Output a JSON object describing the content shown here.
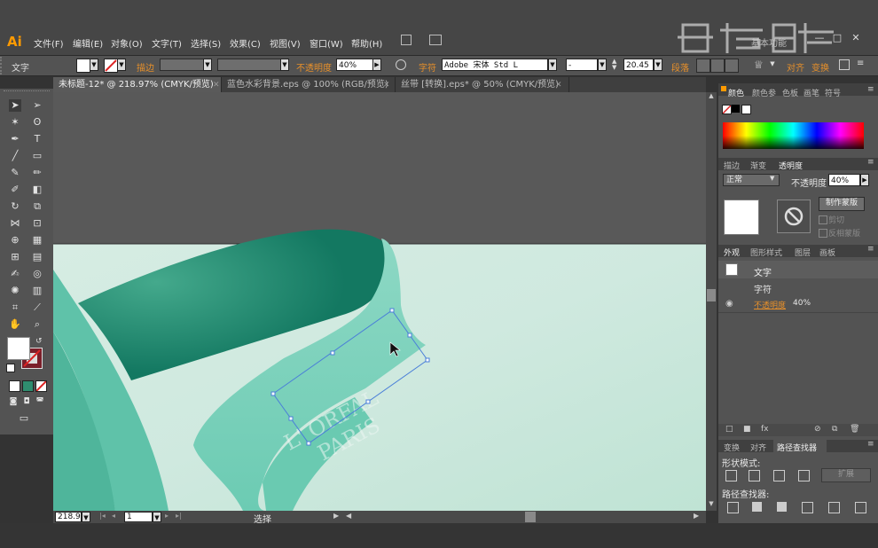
{
  "app": {
    "logo": "Ai",
    "workspace_button": "基本功能",
    "menus": [
      "文件(F)",
      "编辑(E)",
      "对象(O)",
      "文字(T)",
      "选择(S)",
      "效果(C)",
      "视图(V)",
      "窗口(W)",
      "帮助(H)"
    ],
    "window_controls": [
      "—",
      "□",
      "✕"
    ]
  },
  "control_bar": {
    "object_type": "文字",
    "stroke_label": "描边",
    "opacity_label": "不透明度",
    "opacity_value": "40%",
    "char_label": "字符",
    "font_name": "Adobe 宋体 Std L",
    "font_style": "-",
    "font_size": "20.45",
    "para_label": "段落",
    "align_label": "对齐",
    "transform_label": "变换"
  },
  "tabs": [
    {
      "label": "未标题-12* @ 218.97% (CMYK/预览)",
      "active": true
    },
    {
      "label": "蓝色水彩背景.eps @ 100% (RGB/预览)",
      "active": false
    },
    {
      "label": "丝带 [转换].eps* @ 50% (CMYK/预览)",
      "active": false
    }
  ],
  "artwork": {
    "line1": "L' ORFAL",
    "line2": "PARIS"
  },
  "status": {
    "zoom": "218.97",
    "page": "1",
    "mode": "选择"
  },
  "panels": {
    "color_tabs": [
      "颜色",
      "颜色参",
      "色板",
      "画笔",
      "符号"
    ],
    "transparency_tabs": [
      "描边",
      "渐变",
      "透明度"
    ],
    "blend_mode": "正常",
    "opacity_label": "不透明度",
    "opacity_value": "40%",
    "make_mask": "制作蒙版",
    "clip": "剪切",
    "invert_mask": "反相蒙版",
    "appearance_tabs": [
      "外观",
      "图形样式",
      "图层",
      "画板"
    ],
    "appearance_rows": [
      "文字",
      "字符",
      "不透明度"
    ],
    "appearance_opacity": "40%",
    "pathfinder_tabs": [
      "变换",
      "对齐",
      "路径查找器"
    ],
    "shape_modes": "形状模式:",
    "expand": "扩展",
    "pathfinders": "路径查找器:"
  },
  "colors": {
    "accent_orange": "#e8902a",
    "ribbon_dark": "#197a62",
    "ribbon_light": "#6fcdb5",
    "background_mint": "#cfe9df"
  },
  "watermark": "虎课网"
}
